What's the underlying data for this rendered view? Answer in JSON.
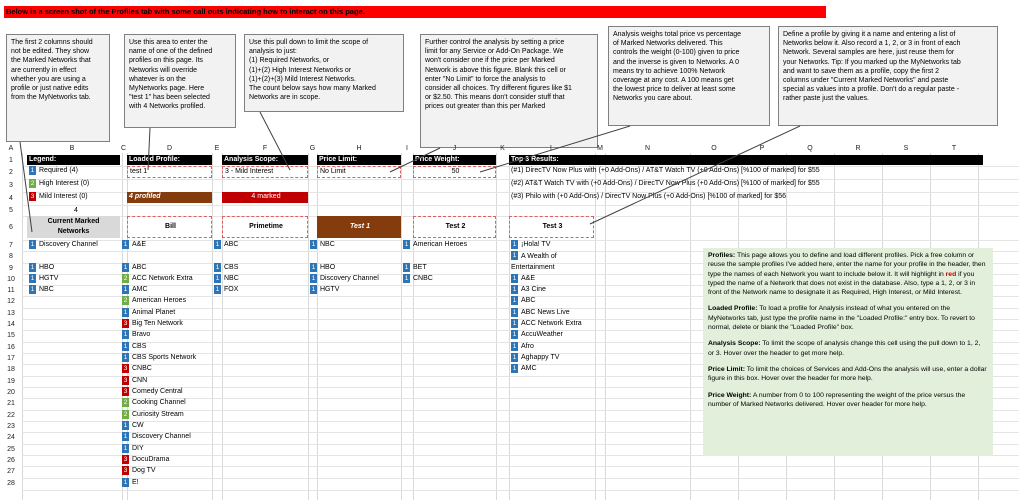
{
  "banner": "Below is a screen shot of the Profiles tab with some call outs indicating how to interact on this page.",
  "callouts": {
    "c1": [
      "The first 2 columns should",
      "not be edited. They show",
      "the Marked Networks that",
      "are currently in effect",
      "whether you are using a",
      "profile or just native edits",
      "from the MyNetworks tab."
    ],
    "c2": [
      "Use this area to enter the",
      "name of one of the defined",
      "profiles on this page. Its",
      "Networks will override",
      "whatever is on the",
      "MyNetworks page. Here",
      "\"test 1\" has been selected",
      "with 4 Networks profiled."
    ],
    "c3": [
      "Use this pull down to limit the scope of",
      "analysis to just:",
      "(1) Required Networks, or",
      "(1)+(2) High Interest Networks or",
      "(1)+(2)+(3) Mild Interest Networks.",
      "The count below says how many Marked",
      "Networks are in scope."
    ],
    "c4": [
      "Further control the analysis by setting a price",
      "limit for any Service or Add-On Package. We",
      "won't consider one if the price per Marked",
      "Network is above this figure. Blank this cell or",
      "enter \"No Limit\" to force the analysis to",
      "consider all choices. Try different figures like $1",
      "or $2.50. This means don't consider stuff that",
      "prices out greater than this per Marked"
    ],
    "c5": [
      "Analysis weighs total price vs percentage",
      "of Marked Networks delivered. This",
      "controls the weight (0-100) given to price",
      "and the inverse is given to Networks. A 0",
      "means try to achieve 100% Network",
      "coverage at any cost. A 100 means get",
      "the lowest price to deliver at least some",
      "Networks you care about."
    ],
    "c6": [
      "Define a profile by giving it a name and entering a list of",
      "Networks below it. Also record a 1, 2, or 3 in front of each",
      "Network. Several samples are here, just reuse them for",
      "your Networks. Tip: If you marked up the MyNetworks tab",
      "and want to save them as a profile, copy the first 2",
      "columns under \"Current Marked Networks\" and paste",
      "special as values into a profile. Don't do a regular paste -",
      "rather paste just the values."
    ]
  },
  "columns": [
    "A",
    "B",
    "C",
    "D",
    "E",
    "F",
    "G",
    "H",
    "I",
    "J",
    "K",
    "L",
    "M",
    "N",
    "O",
    "P",
    "Q",
    "R",
    "S",
    "T"
  ],
  "rows": [
    "1",
    "2",
    "3",
    "4",
    "5",
    "6",
    "7",
    "8",
    "9",
    "10",
    "11",
    "12",
    "13",
    "14",
    "15",
    "16",
    "17",
    "18",
    "19",
    "20",
    "21",
    "22",
    "23",
    "24",
    "25",
    "26",
    "27",
    "28"
  ],
  "legend": {
    "header": "Legend:",
    "items": [
      {
        "num": "1",
        "label": "Required (4)"
      },
      {
        "num": "2",
        "label": "High Interest (0)"
      },
      {
        "num": "3",
        "label": "Mild Interest (0)"
      }
    ],
    "count": "4"
  },
  "loaded_profile": {
    "header": "Loaded Profile:",
    "value": "test 1",
    "badge": "4 profiled"
  },
  "analysis_scope": {
    "header": "Analysis Scope:",
    "value": "3 - Mild Interest",
    "badge": "4 marked"
  },
  "price_limit": {
    "header": "Price Limit:",
    "value": "No Limit"
  },
  "price_weight": {
    "header": "Price Weight:",
    "value": "50"
  },
  "top_results": {
    "header": "Top 3 Results:",
    "lines": [
      "(#1) DirecTV Now Plus with (+0 Add-Ons) / AT&T Watch TV (+0 Add-Ons)  [%100 of marked] for $55",
      "(#2) AT&T Watch TV with (+0 Add-Ons) / DirecTV Now Plus (+0 Add-Ons)  [%100 of marked] for $55",
      "(#3) Philo with (+0 Add-Ons) / DirecTV Now Plus (+0 Add-Ons)  [%100 of marked] for $56"
    ]
  },
  "profile_headers": {
    "current": "Current Marked Networks",
    "bill": "Bill",
    "primetime": "Primetime",
    "test1": "Test 1",
    "test2": "Test 2",
    "test3": "Test 3"
  },
  "current_networks": [
    {
      "num": "1",
      "name": "Discovery Channel"
    },
    {
      "num": "1",
      "name": "HBO"
    },
    {
      "num": "1",
      "name": "HGTV"
    },
    {
      "num": "1",
      "name": "NBC"
    }
  ],
  "bill_networks": [
    {
      "num": "1",
      "name": "A&E"
    },
    {
      "num": "1",
      "name": "ABC"
    },
    {
      "num": "2",
      "name": "ACC Network Extra"
    },
    {
      "num": "1",
      "name": "AMC"
    },
    {
      "num": "2",
      "name": "American Heroes"
    },
    {
      "num": "1",
      "name": "Animal Planet"
    },
    {
      "num": "3",
      "name": "Big Ten Network"
    },
    {
      "num": "1",
      "name": "Bravo"
    },
    {
      "num": "1",
      "name": "CBS"
    },
    {
      "num": "1",
      "name": "CBS Sports Network"
    },
    {
      "num": "3",
      "name": "CNBC"
    },
    {
      "num": "3",
      "name": "CNN"
    },
    {
      "num": "3",
      "name": "Comedy Central"
    },
    {
      "num": "2",
      "name": "Cooking Channel"
    },
    {
      "num": "2",
      "name": "Curiosity Stream"
    },
    {
      "num": "1",
      "name": "CW"
    },
    {
      "num": "1",
      "name": "Discovery Channel"
    },
    {
      "num": "1",
      "name": "DIY"
    },
    {
      "num": "3",
      "name": "DocuDrama"
    },
    {
      "num": "3",
      "name": "Dog TV"
    },
    {
      "num": "1",
      "name": "E!"
    }
  ],
  "primetime_networks": [
    {
      "num": "1",
      "name": "ABC"
    },
    {
      "num": "1",
      "name": "CBS"
    },
    {
      "num": "1",
      "name": "NBC"
    },
    {
      "num": "1",
      "name": "FOX"
    }
  ],
  "test1_networks": [
    {
      "num": "1",
      "name": "NBC"
    },
    {
      "num": "1",
      "name": "HBO"
    },
    {
      "num": "1",
      "name": "Discovery Channel"
    },
    {
      "num": "1",
      "name": "HGTV"
    }
  ],
  "test2_networks": [
    {
      "num": "1",
      "name": "American Heroes"
    },
    {
      "num": "1",
      "name": "BET"
    },
    {
      "num": "1",
      "name": "CNBC"
    }
  ],
  "test3_networks": [
    {
      "num": "1",
      "name": "¡Hola! TV"
    },
    {
      "num": "1",
      "name": "A Wealth of Entertainment"
    },
    {
      "num": "1",
      "name": "A&E"
    },
    {
      "num": "1",
      "name": "A3 Cine"
    },
    {
      "num": "1",
      "name": "ABC"
    },
    {
      "num": "1",
      "name": "ABC News Live"
    },
    {
      "num": "1",
      "name": "ACC Network Extra"
    },
    {
      "num": "1",
      "name": "AccuWeather"
    },
    {
      "num": "1",
      "name": "Afro"
    },
    {
      "num": "1",
      "name": "Aghappy TV"
    },
    {
      "num": "1",
      "name": "AMC"
    }
  ],
  "help": {
    "profiles_title": "Profiles:",
    "profiles_text1": "This page allows you to define and load different profiles. Pick a free column or reuse the sample profiles I've added here, enter the name for your profile in the header, then type the names of each Network you want to include below it. It will highlight in",
    "profiles_red": "red",
    "profiles_text2": "if you typed the name of a Network that does not exist in the database. Also, type a 1, 2, or 3 in front of the Network name to designate it as Required, High Interest, or Mild Interest.",
    "loaded_title": "Loaded Profile:",
    "loaded_text": "To load a profile for Analysis instead of what you entered on the MyNetworks tab, just type the profile name in the \"Loaded Profile:\" entry box. To revert to normal, delete or blank the \"Loaded Profile\" box.",
    "scope_title": "Analysis Scope:",
    "scope_text": "To limit the scope of analysis change this cell using the pull down to 1, 2, or 3. Hover over the header to get more help.",
    "limit_title": "Price Limit:",
    "limit_text": "To limit the choices of Services and Add-Ons the analysis will use, enter a dollar figure in this box. Hover over the header for more help.",
    "weight_title": "Price Weight:",
    "weight_text": "A number from 0 to 100 representing the weight of the price versus the number of Marked Networks delivered. Hover over header for more help."
  },
  "colors": {
    "banner": "#ff0000",
    "req": "#2e75b6",
    "high": "#70ad47",
    "mild": "#c00000",
    "badge1": "#843c0c",
    "badge2": "#c00000",
    "help_bg": "#e2efda"
  }
}
